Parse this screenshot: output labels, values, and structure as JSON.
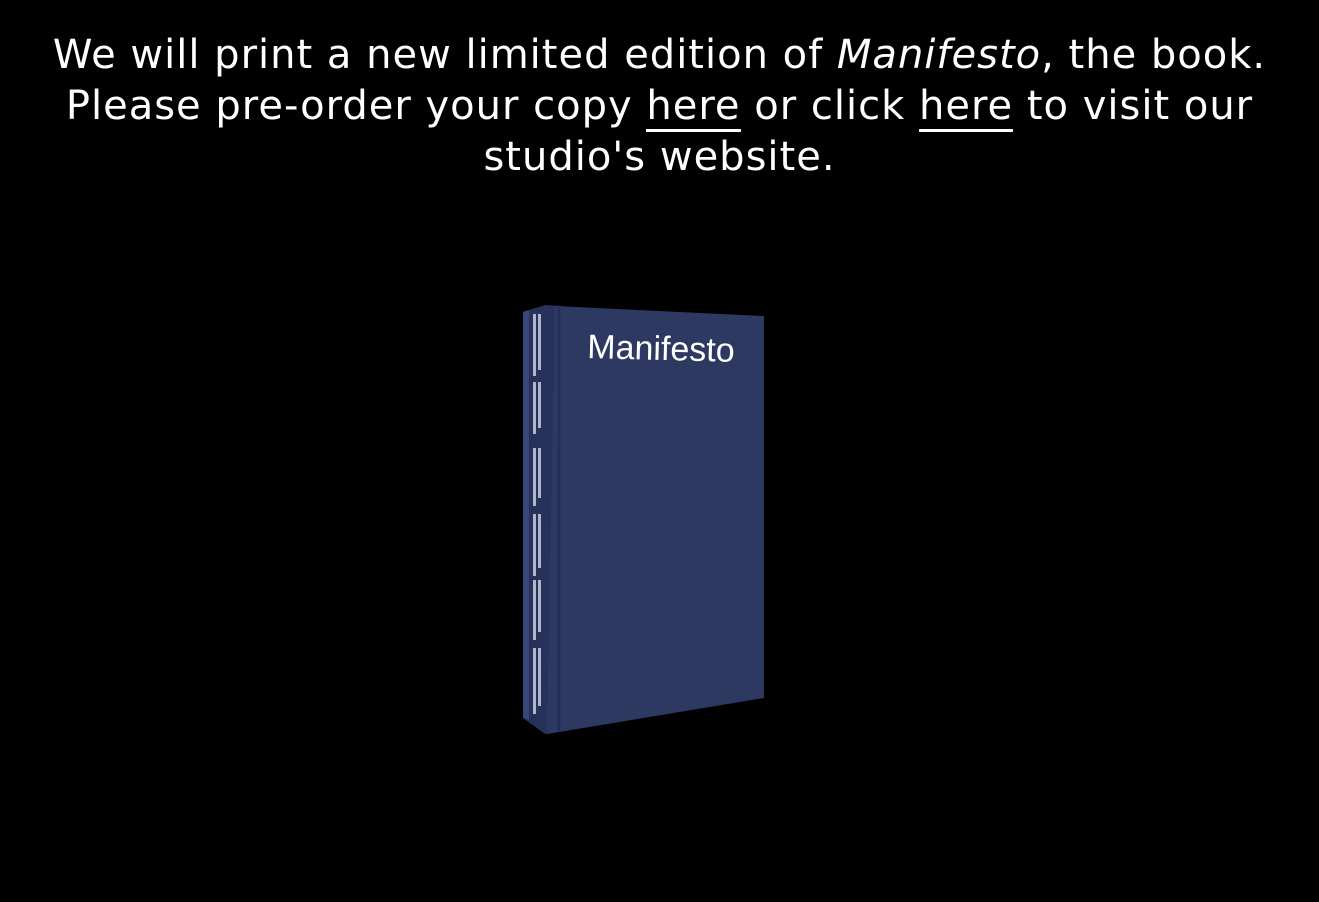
{
  "announcement": {
    "line1_prefix": "We will print a new limited edition of ",
    "book_title": "Manifesto",
    "line1_suffix": ", the book.",
    "line2_prefix": "Please pre-order your copy ",
    "preorder_link": "here",
    "line2_middle": " or click ",
    "studio_link": "here",
    "line2_suffix": " to visit our studio's website."
  },
  "book": {
    "cover_title": "Manifesto",
    "cover_color": "#2e3962",
    "spine_color": "#2a3459"
  },
  "colors": {
    "background": "#000000",
    "text": "#ffffff"
  }
}
